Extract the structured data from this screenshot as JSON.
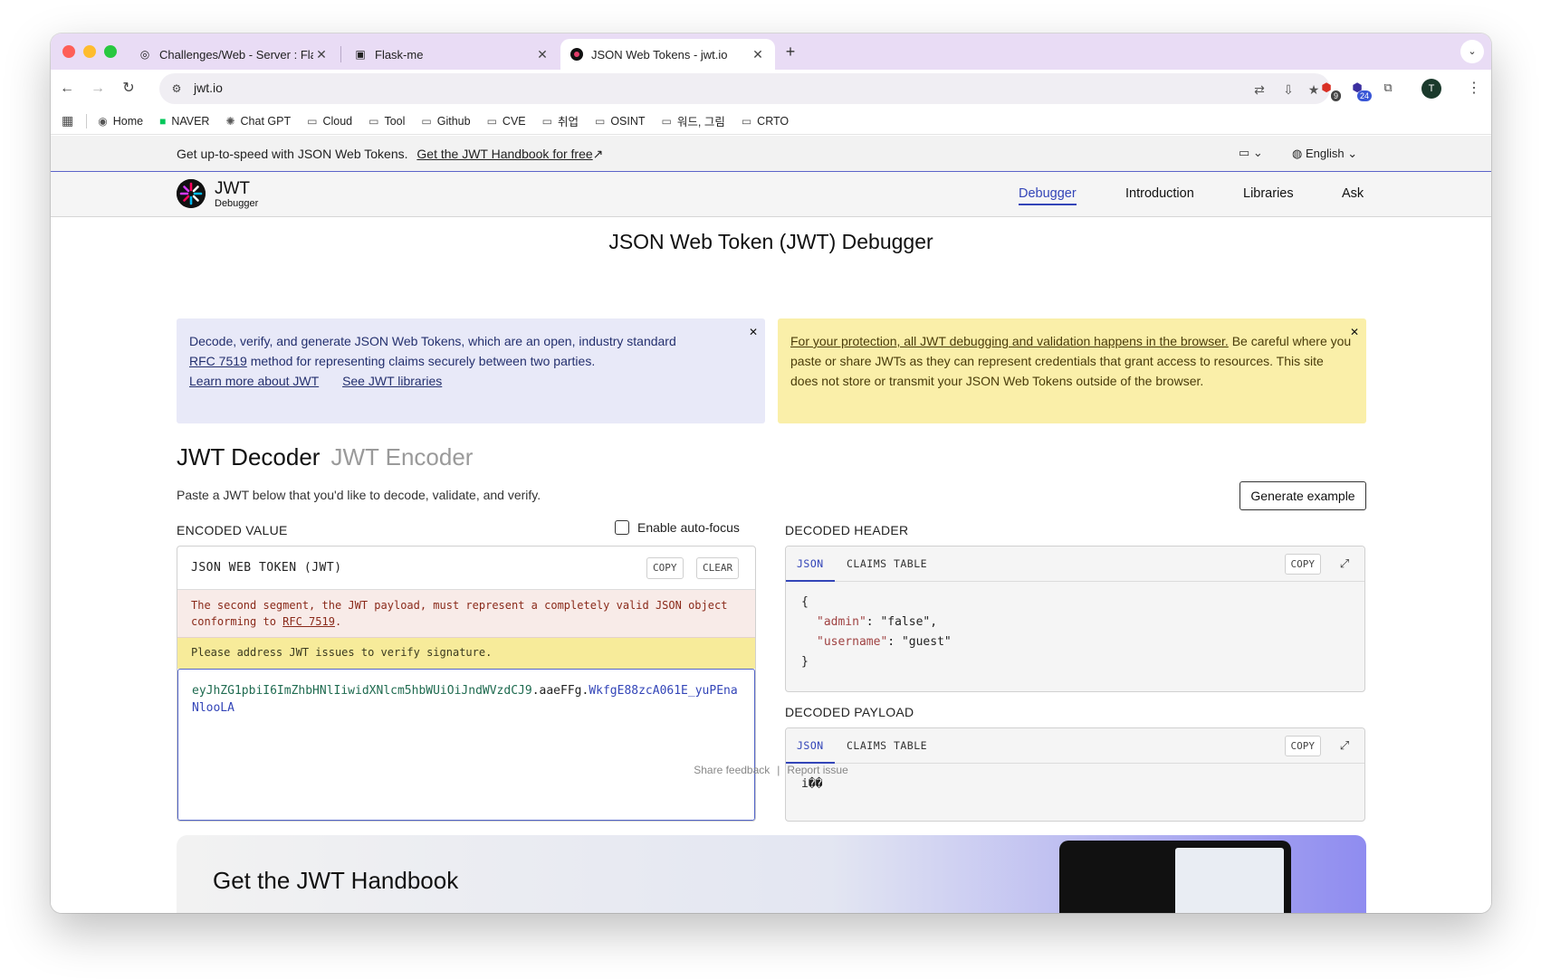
{
  "browser": {
    "tabs": [
      {
        "title": "Challenges/Web - Server : Fla",
        "favicon": "swirl-icon"
      },
      {
        "title": "Flask-me",
        "favicon": "puzzle-icon"
      },
      {
        "title": "JSON Web Tokens - jwt.io",
        "favicon": "jwt-icon",
        "active": true
      }
    ],
    "url": "jwt.io",
    "extension_badges": {
      "ext1": "9",
      "ext2": "24"
    },
    "avatar_letter": "T",
    "bookmarks": [
      "Home",
      "NAVER",
      "Chat GPT",
      "Cloud",
      "Tool",
      "Github",
      "CVE",
      "취업",
      "OSINT",
      "워드, 그림",
      "CRTO"
    ]
  },
  "promo": {
    "text": "Get up-to-speed with JSON Web Tokens.",
    "link": "Get the JWT Handbook for free",
    "language": "English"
  },
  "nav": {
    "logo_title": "JWT",
    "logo_sub": "Debugger",
    "links": [
      "Debugger",
      "Introduction",
      "Libraries",
      "Ask"
    ]
  },
  "main": {
    "title": "JSON Web Token (JWT) Debugger",
    "info_blue": {
      "line1": "Decode, verify, and generate JSON Web Tokens, which are an open, industry standard",
      "rfc": "RFC 7519",
      "line2": " method for representing claims securely between two parties.",
      "link1": "Learn more about JWT",
      "link2": "See JWT libraries"
    },
    "info_yellow": {
      "link": "For your protection, all JWT debugging and validation happens in the browser.",
      "text": " Be careful where you paste or share JWTs as they can represent credentials that grant access to resources. This site does not store or transmit your JSON Web Tokens outside of the browser."
    },
    "decoder_tab": "JWT Decoder",
    "encoder_tab": "JWT Encoder",
    "subtitle": "Paste a JWT below that you'd like to decode, validate, and verify.",
    "generate_button": "Generate example",
    "encoded_label": "ENCODED VALUE",
    "autofocus_label": "Enable auto-focus",
    "enc_title": "JSON WEB TOKEN (JWT)",
    "copy": "COPY",
    "clear": "CLEAR",
    "error_text": "The second segment, the JWT payload, must represent a completely valid JSON object conforming to ",
    "error_rfc": "RFC 7519",
    "error_end": ".",
    "warn_text": "Please address JWT issues to verify signature.",
    "token": {
      "part1": "eyJhZG1pbiI6ImZhbHNlIiwidXNlcm5hbWUiOiJndWVzdCJ9",
      "dot1": ".",
      "part2": "aaeFFg",
      "dot2": ".",
      "part3": "WkfgE88zcA061E_yuPEnaNlooLA"
    },
    "decoded_header_label": "DECODED HEADER",
    "decoded_payload_label": "DECODED PAYLOAD",
    "dec_tab_json": "JSON",
    "dec_tab_claims": "CLAIMS TABLE",
    "header_json": {
      "open": "{",
      "k1": "\"admin\"",
      "v1": "\"false\"",
      "k2": "\"username\"",
      "v2": "\"guest\"",
      "close": "}"
    },
    "payload_text": "i��",
    "share_feedback": "Share feedback",
    "separator": "|",
    "report_issue": "Report issue",
    "handbook_title": "Get the JWT Handbook"
  }
}
